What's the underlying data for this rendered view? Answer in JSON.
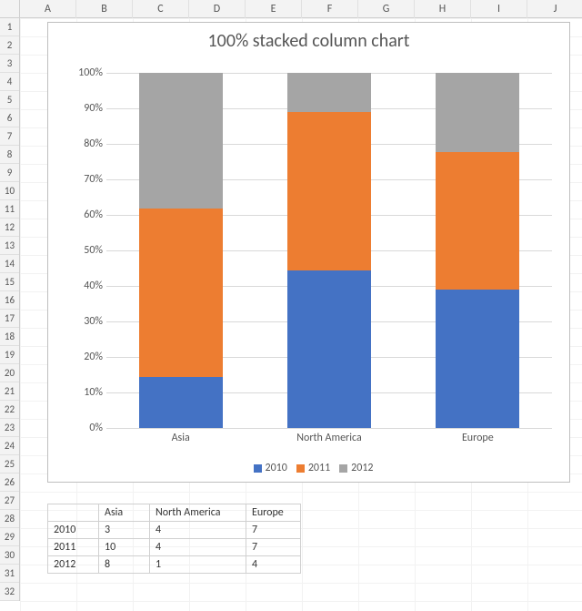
{
  "column_headers": [
    "A",
    "B",
    "C",
    "D",
    "E",
    "F",
    "G",
    "H",
    "I",
    "J"
  ],
  "row_count": 32,
  "chart_data": {
    "type": "bar",
    "stacked": "100%",
    "title": "100% stacked column chart",
    "categories": [
      "Asia",
      "North America",
      "Europe"
    ],
    "series": [
      {
        "name": "2010",
        "values": [
          3,
          4,
          7
        ],
        "color": "#4472c4"
      },
      {
        "name": "2011",
        "values": [
          10,
          4,
          7
        ],
        "color": "#ed7d31"
      },
      {
        "name": "2012",
        "values": [
          8,
          1,
          4
        ],
        "color": "#a5a5a5"
      }
    ],
    "y_ticks": [
      "0%",
      "10%",
      "20%",
      "30%",
      "40%",
      "50%",
      "60%",
      "70%",
      "80%",
      "90%",
      "100%"
    ],
    "ylim": [
      0,
      100
    ]
  },
  "table": {
    "headers": [
      "",
      "Asia",
      "North America",
      "Europe"
    ],
    "rows": [
      [
        "2010",
        "3",
        "4",
        "7"
      ],
      [
        "2011",
        "10",
        "4",
        "7"
      ],
      [
        "2012",
        "8",
        "1",
        "4"
      ]
    ]
  }
}
